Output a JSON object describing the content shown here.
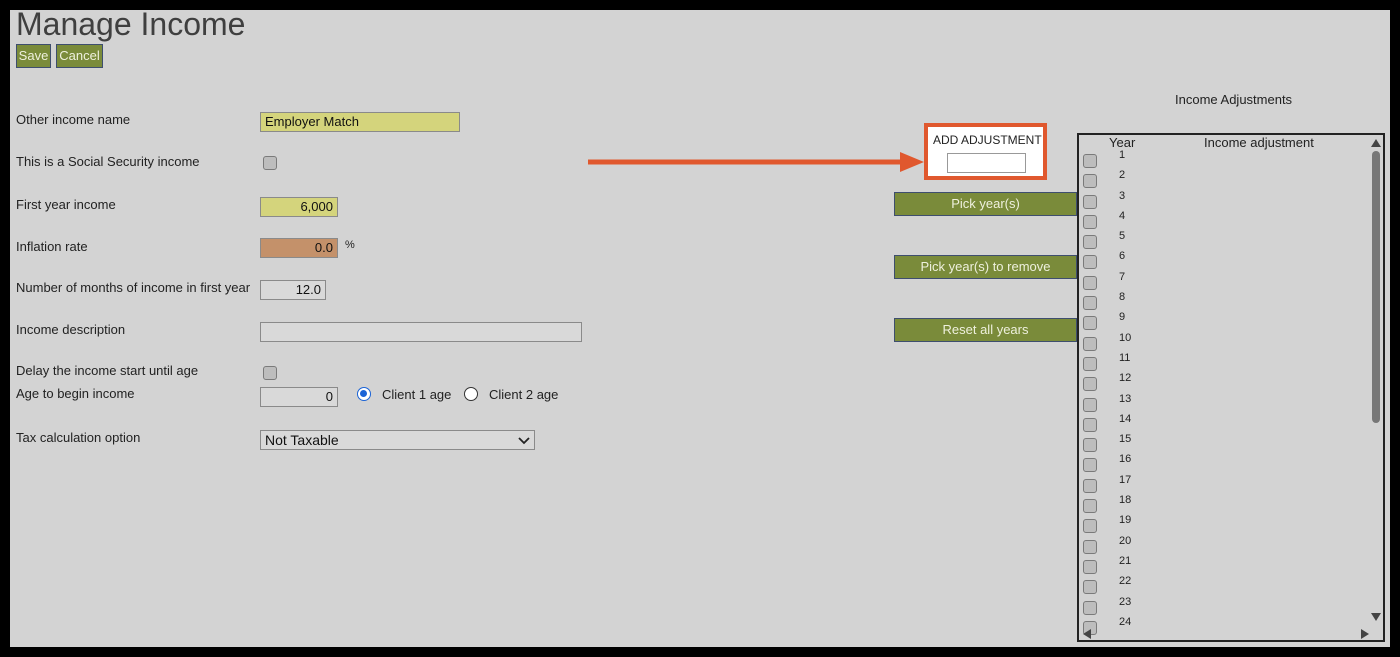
{
  "header": {
    "title": "Manage Income"
  },
  "toolbar": {
    "save_label": "Save",
    "cancel_label": "Cancel"
  },
  "form": {
    "other_income_name_label": "Other income name",
    "other_income_name_value": "Employer Match",
    "social_security_label": "This is a Social Security income",
    "first_year_income_label": "First year income",
    "first_year_income_value": "6,000",
    "inflation_rate_label": "Inflation rate",
    "inflation_rate_value": "0.0",
    "percent_symbol": "%",
    "months_label": "Number of months of income in first year",
    "months_value": "12.0",
    "description_label": "Income description",
    "description_value": "",
    "delay_label": "Delay the income start until age",
    "age_begin_label": "Age to begin income",
    "age_begin_value": "0",
    "client1_label": "Client 1 age",
    "client2_label": "Client 2 age",
    "tax_label": "Tax calculation option",
    "tax_value": "Not Taxable"
  },
  "adjust": {
    "add_label": "ADD ADJUSTMENT",
    "add_value": "",
    "pick_years_label": "Pick year(s)",
    "pick_remove_label": "Pick year(s) to remove",
    "reset_label": "Reset all years"
  },
  "panel": {
    "title": "Income Adjustments",
    "col_year": "Year",
    "col_adjustment": "Income adjustment",
    "years": [
      "1",
      "2",
      "3",
      "4",
      "5",
      "6",
      "7",
      "8",
      "9",
      "10",
      "11",
      "12",
      "13",
      "14",
      "15",
      "16",
      "17",
      "18",
      "19",
      "20",
      "21",
      "22",
      "23",
      "24"
    ]
  },
  "colors": {
    "page_bg": "#d3d3d3",
    "button_green": "#7a8b3a",
    "highlight_yellow": "#d4d47c",
    "inflation_tan": "#c4916a",
    "annotation_orange": "#e0582e"
  }
}
